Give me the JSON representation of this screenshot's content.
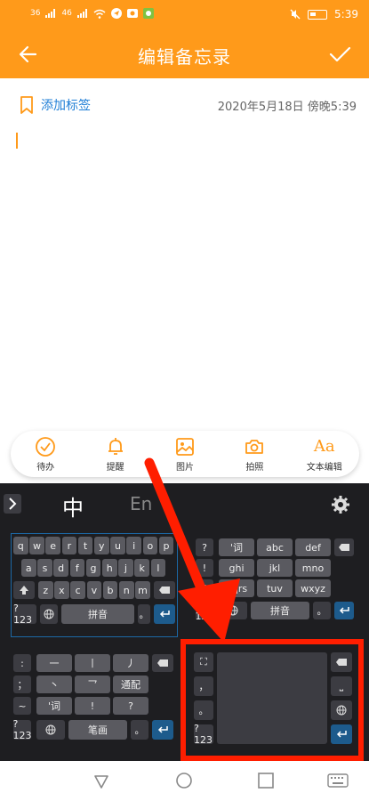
{
  "status": {
    "sig1": "36",
    "sig2": "46",
    "time": "5:39"
  },
  "header": {
    "title": "编辑备忘录"
  },
  "editor": {
    "tag_label": "添加标签",
    "date": "2020年5月18日 傍晚5:39"
  },
  "toolbar": [
    {
      "label": "待办",
      "icon": "check-circle-icon"
    },
    {
      "label": "提醒",
      "icon": "bell-icon"
    },
    {
      "label": "图片",
      "icon": "image-icon"
    },
    {
      "label": "拍照",
      "icon": "camera-icon"
    },
    {
      "label": "文本编辑",
      "icon": "text-edit-icon",
      "glyph": "Aa"
    }
  ],
  "keyboard": {
    "mode_zh": "中",
    "mode_en": "En",
    "qwerty": {
      "row1": [
        "q",
        "w",
        "e",
        "r",
        "t",
        "y",
        "u",
        "i",
        "o",
        "p"
      ],
      "row2": [
        "a",
        "s",
        "d",
        "f",
        "g",
        "h",
        "j",
        "k",
        "l"
      ],
      "row3": [
        "z",
        "x",
        "c",
        "v",
        "b",
        "n",
        "m"
      ],
      "num": "?123",
      "space": "拼音",
      "dot": "。"
    },
    "t9": {
      "side": [
        "?",
        "!",
        "@"
      ],
      "keys": [
        "'词",
        "abc",
        "def",
        "ghi",
        "jkl",
        "mno",
        "pqrs",
        "tuv",
        "wxyz"
      ],
      "num": "?123",
      "space": "拼音",
      "dot": "。"
    },
    "stroke": {
      "side": [
        ":",
        "；",
        "~"
      ],
      "keys": [
        "一",
        "丨",
        "丿",
        "丶",
        "乛",
        "通配",
        "'词",
        "!",
        "?"
      ],
      "num": "?123",
      "space": "笔画",
      "dot": "。"
    },
    "handwriting": {
      "side": [
        "，",
        "。"
      ],
      "num": "?123"
    }
  },
  "colors": {
    "accent": "#ff9a1a",
    "link": "#1f7ed6",
    "highlight": "#ff1e00",
    "keyboard_bg": "#1e1e21"
  }
}
